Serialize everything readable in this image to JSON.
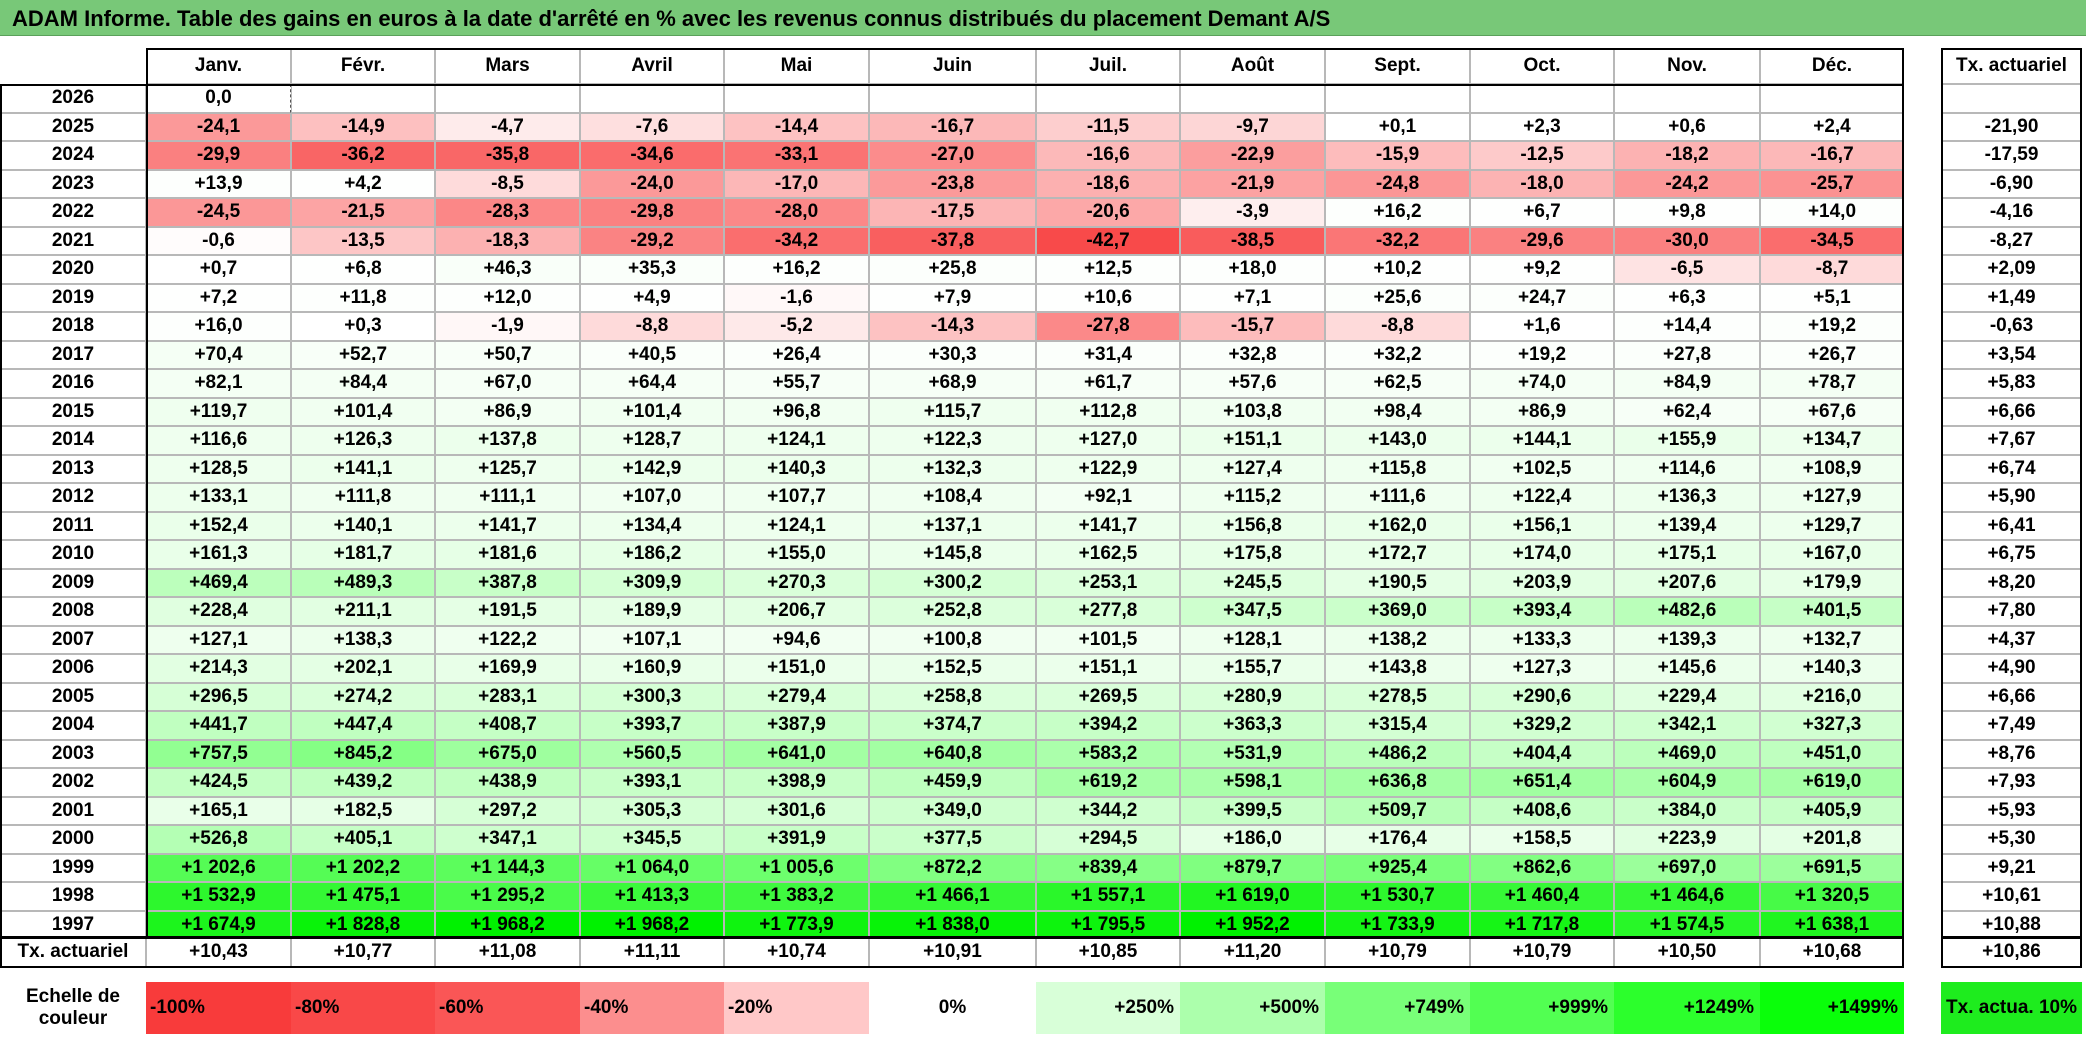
{
  "title": "ADAM Informe. Table des gains en euros à la date d'arrêté en % avec les revenus connus distribués du placement Demant A/S",
  "months": [
    "Janv.",
    "Févr.",
    "Mars",
    "Avril",
    "Mai",
    "Juin",
    "Juil.",
    "Août",
    "Sept.",
    "Oct.",
    "Nov.",
    "Déc."
  ],
  "rate_header": "Tx. actuariel",
  "rows": [
    {
      "year": "2026",
      "values": [
        "0,0",
        "",
        "",
        "",
        "",
        "",
        "",
        "",
        "",
        "",
        "",
        ""
      ],
      "rate": ""
    },
    {
      "year": "2025",
      "values": [
        "-24,1",
        "-14,9",
        "-4,7",
        "-7,6",
        "-14,4",
        "-16,7",
        "-11,5",
        "-9,7",
        "+0,1",
        "+2,3",
        "+0,6",
        "+2,4"
      ],
      "rate": "-21,90"
    },
    {
      "year": "2024",
      "values": [
        "-29,9",
        "-36,2",
        "-35,8",
        "-34,6",
        "-33,1",
        "-27,0",
        "-16,6",
        "-22,9",
        "-15,9",
        "-12,5",
        "-18,2",
        "-16,7"
      ],
      "rate": "-17,59"
    },
    {
      "year": "2023",
      "values": [
        "+13,9",
        "+4,2",
        "-8,5",
        "-24,0",
        "-17,0",
        "-23,8",
        "-18,6",
        "-21,9",
        "-24,8",
        "-18,0",
        "-24,2",
        "-25,7"
      ],
      "rate": "-6,90"
    },
    {
      "year": "2022",
      "values": [
        "-24,5",
        "-21,5",
        "-28,3",
        "-29,8",
        "-28,0",
        "-17,5",
        "-20,6",
        "-3,9",
        "+16,2",
        "+6,7",
        "+9,8",
        "+14,0"
      ],
      "rate": "-4,16"
    },
    {
      "year": "2021",
      "values": [
        "-0,6",
        "-13,5",
        "-18,3",
        "-29,2",
        "-34,2",
        "-37,8",
        "-42,7",
        "-38,5",
        "-32,2",
        "-29,6",
        "-30,0",
        "-34,5"
      ],
      "rate": "-8,27"
    },
    {
      "year": "2020",
      "values": [
        "+0,7",
        "+6,8",
        "+46,3",
        "+35,3",
        "+16,2",
        "+25,8",
        "+12,5",
        "+18,0",
        "+10,2",
        "+9,2",
        "-6,5",
        "-8,7"
      ],
      "rate": "+2,09"
    },
    {
      "year": "2019",
      "values": [
        "+7,2",
        "+11,8",
        "+12,0",
        "+4,9",
        "-1,6",
        "+7,9",
        "+10,6",
        "+7,1",
        "+25,6",
        "+24,7",
        "+6,3",
        "+5,1"
      ],
      "rate": "+1,49"
    },
    {
      "year": "2018",
      "values": [
        "+16,0",
        "+0,3",
        "-1,9",
        "-8,8",
        "-5,2",
        "-14,3",
        "-27,8",
        "-15,7",
        "-8,8",
        "+1,6",
        "+14,4",
        "+19,2"
      ],
      "rate": "-0,63"
    },
    {
      "year": "2017",
      "values": [
        "+70,4",
        "+52,7",
        "+50,7",
        "+40,5",
        "+26,4",
        "+30,3",
        "+31,4",
        "+32,8",
        "+32,2",
        "+19,2",
        "+27,8",
        "+26,7"
      ],
      "rate": "+3,54"
    },
    {
      "year": "2016",
      "values": [
        "+82,1",
        "+84,4",
        "+67,0",
        "+64,4",
        "+55,7",
        "+68,9",
        "+61,7",
        "+57,6",
        "+62,5",
        "+74,0",
        "+84,9",
        "+78,7"
      ],
      "rate": "+5,83"
    },
    {
      "year": "2015",
      "values": [
        "+119,7",
        "+101,4",
        "+86,9",
        "+101,4",
        "+96,8",
        "+115,7",
        "+112,8",
        "+103,8",
        "+98,4",
        "+86,9",
        "+62,4",
        "+67,6"
      ],
      "rate": "+6,66"
    },
    {
      "year": "2014",
      "values": [
        "+116,6",
        "+126,3",
        "+137,8",
        "+128,7",
        "+124,1",
        "+122,3",
        "+127,0",
        "+151,1",
        "+143,0",
        "+144,1",
        "+155,9",
        "+134,7"
      ],
      "rate": "+7,67"
    },
    {
      "year": "2013",
      "values": [
        "+128,5",
        "+141,1",
        "+125,7",
        "+142,9",
        "+140,3",
        "+132,3",
        "+122,9",
        "+127,4",
        "+115,8",
        "+102,5",
        "+114,6",
        "+108,9"
      ],
      "rate": "+6,74"
    },
    {
      "year": "2012",
      "values": [
        "+133,1",
        "+111,8",
        "+111,1",
        "+107,0",
        "+107,7",
        "+108,4",
        "+92,1",
        "+115,2",
        "+111,6",
        "+122,4",
        "+136,3",
        "+127,9"
      ],
      "rate": "+5,90"
    },
    {
      "year": "2011",
      "values": [
        "+152,4",
        "+140,1",
        "+141,7",
        "+134,4",
        "+124,1",
        "+137,1",
        "+141,7",
        "+156,8",
        "+162,0",
        "+156,1",
        "+139,4",
        "+129,7"
      ],
      "rate": "+6,41"
    },
    {
      "year": "2010",
      "values": [
        "+161,3",
        "+181,7",
        "+181,6",
        "+186,2",
        "+155,0",
        "+145,8",
        "+162,5",
        "+175,8",
        "+172,7",
        "+174,0",
        "+175,1",
        "+167,0"
      ],
      "rate": "+6,75"
    },
    {
      "year": "2009",
      "values": [
        "+469,4",
        "+489,3",
        "+387,8",
        "+309,9",
        "+270,3",
        "+300,2",
        "+253,1",
        "+245,5",
        "+190,5",
        "+203,9",
        "+207,6",
        "+179,9"
      ],
      "rate": "+8,20"
    },
    {
      "year": "2008",
      "values": [
        "+228,4",
        "+211,1",
        "+191,5",
        "+189,9",
        "+206,7",
        "+252,8",
        "+277,8",
        "+347,5",
        "+369,0",
        "+393,4",
        "+482,6",
        "+401,5"
      ],
      "rate": "+7,80"
    },
    {
      "year": "2007",
      "values": [
        "+127,1",
        "+138,3",
        "+122,2",
        "+107,1",
        "+94,6",
        "+100,8",
        "+101,5",
        "+128,1",
        "+138,2",
        "+133,3",
        "+139,3",
        "+132,7"
      ],
      "rate": "+4,37"
    },
    {
      "year": "2006",
      "values": [
        "+214,3",
        "+202,1",
        "+169,9",
        "+160,9",
        "+151,0",
        "+152,5",
        "+151,1",
        "+155,7",
        "+143,8",
        "+127,3",
        "+145,6",
        "+140,3"
      ],
      "rate": "+4,90"
    },
    {
      "year": "2005",
      "values": [
        "+296,5",
        "+274,2",
        "+283,1",
        "+300,3",
        "+279,4",
        "+258,8",
        "+269,5",
        "+280,9",
        "+278,5",
        "+290,6",
        "+229,4",
        "+216,0"
      ],
      "rate": "+6,66"
    },
    {
      "year": "2004",
      "values": [
        "+441,7",
        "+447,4",
        "+408,7",
        "+393,7",
        "+387,9",
        "+374,7",
        "+394,2",
        "+363,3",
        "+315,4",
        "+329,2",
        "+342,1",
        "+327,3"
      ],
      "rate": "+7,49"
    },
    {
      "year": "2003",
      "values": [
        "+757,5",
        "+845,2",
        "+675,0",
        "+560,5",
        "+641,0",
        "+640,8",
        "+583,2",
        "+531,9",
        "+486,2",
        "+404,4",
        "+469,0",
        "+451,0"
      ],
      "rate": "+8,76"
    },
    {
      "year": "2002",
      "values": [
        "+424,5",
        "+439,2",
        "+438,9",
        "+393,1",
        "+398,9",
        "+459,9",
        "+619,2",
        "+598,1",
        "+636,8",
        "+651,4",
        "+604,9",
        "+619,0"
      ],
      "rate": "+7,93"
    },
    {
      "year": "2001",
      "values": [
        "+165,1",
        "+182,5",
        "+297,2",
        "+305,3",
        "+301,6",
        "+349,0",
        "+344,2",
        "+399,5",
        "+509,7",
        "+408,6",
        "+384,0",
        "+405,9"
      ],
      "rate": "+5,93"
    },
    {
      "year": "2000",
      "values": [
        "+526,8",
        "+405,1",
        "+347,1",
        "+345,5",
        "+391,9",
        "+377,5",
        "+294,5",
        "+186,0",
        "+176,4",
        "+158,5",
        "+223,9",
        "+201,8"
      ],
      "rate": "+5,30"
    },
    {
      "year": "1999",
      "values": [
        "+1 202,6",
        "+1 202,2",
        "+1 144,3",
        "+1 064,0",
        "+1 005,6",
        "+872,2",
        "+839,4",
        "+879,7",
        "+925,4",
        "+862,6",
        "+697,0",
        "+691,5"
      ],
      "rate": "+9,21"
    },
    {
      "year": "1998",
      "values": [
        "+1 532,9",
        "+1 475,1",
        "+1 295,2",
        "+1 413,3",
        "+1 383,2",
        "+1 466,1",
        "+1 557,1",
        "+1 619,0",
        "+1 530,7",
        "+1 460,4",
        "+1 464,6",
        "+1 320,5"
      ],
      "rate": "+10,61"
    },
    {
      "year": "1997",
      "values": [
        "+1 674,9",
        "+1 828,8",
        "+1 968,2",
        "+1 968,2",
        "+1 773,9",
        "+1 838,0",
        "+1 795,5",
        "+1 952,2",
        "+1 733,9",
        "+1 717,8",
        "+1 574,5",
        "+1 638,1"
      ],
      "rate": "+10,88"
    }
  ],
  "footer": {
    "label": "Tx. actuariel",
    "values": [
      "+10,43",
      "+10,77",
      "+11,08",
      "+11,11",
      "+10,74",
      "+10,91",
      "+10,85",
      "+11,20",
      "+10,79",
      "+10,79",
      "+10,50",
      "+10,68"
    ],
    "rate": "+10,86"
  },
  "scale": {
    "label": "Echelle de couleur",
    "items": [
      {
        "text": "-100%",
        "color": "#f83b3b",
        "align": "left"
      },
      {
        "text": "-80%",
        "color": "#f94848",
        "align": "left"
      },
      {
        "text": "-60%",
        "color": "#fa5656",
        "align": "left"
      },
      {
        "text": "-40%",
        "color": "#fc8e8e",
        "align": "left"
      },
      {
        "text": "-20%",
        "color": "#ffc8c8",
        "align": "left"
      },
      {
        "text": "0%",
        "color": "#ffffff",
        "align": "center"
      },
      {
        "text": "+250%",
        "color": "#d8ffd8",
        "align": "right"
      },
      {
        "text": "+500%",
        "color": "#acffac",
        "align": "right"
      },
      {
        "text": "+749%",
        "color": "#78ff78",
        "align": "right"
      },
      {
        "text": "+999%",
        "color": "#52ff52",
        "align": "right"
      },
      {
        "text": "+1249%",
        "color": "#2cff2c",
        "align": "right"
      },
      {
        "text": "+1499%",
        "color": "#0aff0a",
        "align": "right"
      }
    ],
    "rate_label": "Tx. actua. 10%",
    "rate_color": "#1eec1e"
  }
}
